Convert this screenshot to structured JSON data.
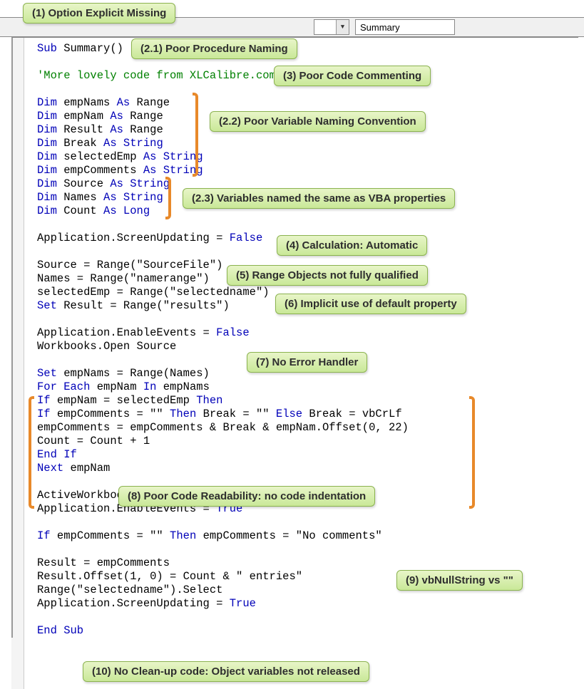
{
  "toolbar": {
    "proc_dropdown_value": "Summary"
  },
  "code": {
    "l01a": "Sub",
    "l01b": " Summary()",
    "l03": "'More lovely code from XLCalibre.com!",
    "l05a": "Dim",
    "l05b": " empNams ",
    "l05c": "As",
    "l05d": " Range",
    "l06a": "Dim",
    "l06b": " empNam ",
    "l06c": "As",
    "l06d": " Range",
    "l07a": "Dim",
    "l07b": " Result ",
    "l07c": "As",
    "l07d": " Range",
    "l08a": "Dim",
    "l08b": " Break ",
    "l08c": "As String",
    "l09a": "Dim",
    "l09b": " selectedEmp ",
    "l09c": "As String",
    "l10a": "Dim",
    "l10b": " empComments ",
    "l10c": "As String",
    "l11a": "Dim",
    "l11b": " Source ",
    "l11c": "As String",
    "l12a": "Dim",
    "l12b": " Names ",
    "l12c": "As String",
    "l13a": "Dim",
    "l13b": " Count ",
    "l13c": "As Long",
    "l15": "Application.ScreenUpdating = ",
    "l15b": "False",
    "l17": "Source = Range(\"SourceFile\")",
    "l18": "Names = Range(\"namerange\")",
    "l19": "selectedEmp = Range(\"selectedname\")",
    "l20a": "Set",
    "l20b": " Result = Range(\"results\")",
    "l22": "Application.EnableEvents = ",
    "l22b": "False",
    "l23": "Workbooks.Open Source",
    "l25a": "Set",
    "l25b": " empNams = Range(Names)",
    "l26a": "For Each",
    "l26b": " empNam ",
    "l26c": "In",
    "l26d": " empNams",
    "l27a": "If",
    "l27b": " empNam = selectedEmp ",
    "l27c": "Then",
    "l28a": "If",
    "l28b": " empComments = \"\" ",
    "l28c": "Then",
    "l28d": " Break = \"\" ",
    "l28e": "Else",
    "l28f": " Break = vbCrLf",
    "l29": "empComments = empComments & Break & empNam.Offset(0, 22)",
    "l30": "Count = Count + 1",
    "l31": "End If",
    "l32a": "Next",
    "l32b": " empNam",
    "l34": "ActiveWorkbook.Close",
    "l35": "Application.EnableEvents = ",
    "l35b": "True",
    "l37a": "If",
    "l37b": " empComments = \"\" ",
    "l37c": "Then",
    "l37d": " empComments = \"No comments\"",
    "l39": "Result = empComments",
    "l40": "Result.Offset(1, 0) = Count & \" entries\"",
    "l41": "Range(\"selectedname\").Select",
    "l42": "Application.ScreenUpdating = ",
    "l42b": "True",
    "l44": "End Sub"
  },
  "callouts": {
    "c1": "(1) Option Explicit Missing",
    "c21": "(2.1) Poor Procedure Naming",
    "c3": "(3) Poor Code Commenting",
    "c22": "(2.2) Poor Variable Naming Convention",
    "c23": "(2.3) Variables named the same as VBA properties",
    "c4": "(4) Calculation: Automatic",
    "c5": "(5) Range Objects not fully qualified",
    "c6": "(6) Implicit use of default property",
    "c7": "(7) No Error Handler",
    "c8": "(8) Poor Code Readability: no code indentation",
    "c9": "(9) vbNullString vs \"\"",
    "c10": "(10) No Clean-up code: Object variables not released"
  }
}
